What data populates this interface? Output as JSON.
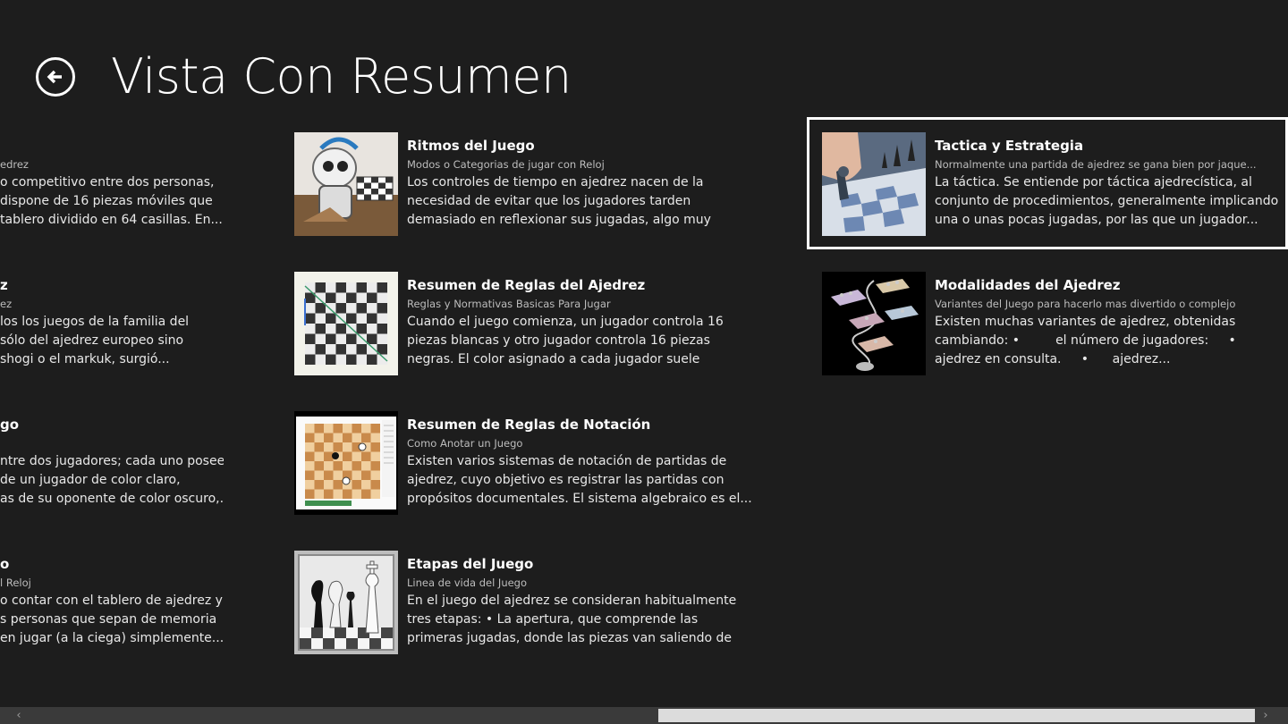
{
  "header": {
    "title": "Vista Con Resumen",
    "back_icon": "back-arrow-icon"
  },
  "partial_column": [
    {
      "title": "",
      "subtitle": "edrez",
      "lines": [
        "o competitivo entre dos personas,",
        " dispone de 16 piezas móviles que",
        "tablero dividido en 64 casillas. En..."
      ]
    },
    {
      "title": "z",
      "subtitle": "ez",
      "lines": [
        "los los juegos de la familia del",
        "sólo del ajedrez europeo sino",
        " shogi o el markuk, surgió..."
      ]
    },
    {
      "title": "go",
      "subtitle": "",
      "lines": [
        "ntre dos jugadores; cada uno posee",
        "de un jugador de color claro,",
        "as de su oponente de color oscuro,..."
      ]
    },
    {
      "title": "o",
      "subtitle": "l Reloj",
      "lines": [
        "o contar con el tablero de ajedrez y",
        "s personas que sepan de memoria",
        "en jugar (a la ciega) simplemente..."
      ]
    }
  ],
  "items": [
    {
      "title": "Ritmos del Juego",
      "subtitle": "Modos o Categorias de jugar con Reloj",
      "description": "Los controles de tiempo en ajedrez nacen de la necesidad de evitar que los jugadores tarden demasiado en reflexionar sus jugadas, algo muy común hasta...",
      "thumb": "robot-chess-image"
    },
    {
      "title": "Resumen de Reglas del Ajedrez",
      "subtitle": "Reglas y Normativas Basicas Para Jugar",
      "description": "Cuando el juego comienza, un jugador controla 16 piezas blancas y otro jugador controla 16 piezas negras. El color asignado a cada jugador suele sortearse,...",
      "thumb": "chessboard-image"
    },
    {
      "title": "Resumen de Reglas de Notación",
      "subtitle": "Como Anotar un Juego",
      "description": "Existen varios sistemas de notación de partidas de ajedrez, cuyo objetivo es registrar las partidas con propósitos documentales. El sistema algebraico es el...",
      "thumb": "notation-board-image"
    },
    {
      "title": "Etapas del Juego",
      "subtitle": "Linea de vida del Juego",
      "description": "En el juego del ajedrez se consideran habitualmente tres etapas: • La apertura, que comprende las primeras jugadas, donde las piezas van saliendo de sus casillas...",
      "thumb": "chess-pieces-image"
    },
    {
      "title": "Tactica y Estrategia",
      "subtitle": "Normalmente una partida de ajedrez se gana bien por jaque...",
      "description": "La táctica. Se entiende por táctica ajedrecística, al conjunto de procedimientos, generalmente implicando una o unas pocas jugadas, por las que un jugador...",
      "thumb": "hand-moving-piece-image"
    },
    {
      "title": "Modalidades del Ajedrez",
      "subtitle": "Variantes del Juego para hacerlo mas divertido o complejo",
      "description": "Existen muchas variantes de ajedrez, obtenidas cambiando: •         el número de jugadores:     •               ajedrez en consulta.     •      ajedrez...",
      "thumb": "3d-chess-image"
    }
  ],
  "scrollbar": {
    "left_arrow": "‹",
    "right_arrow": "›",
    "position_fraction": 0.51
  }
}
